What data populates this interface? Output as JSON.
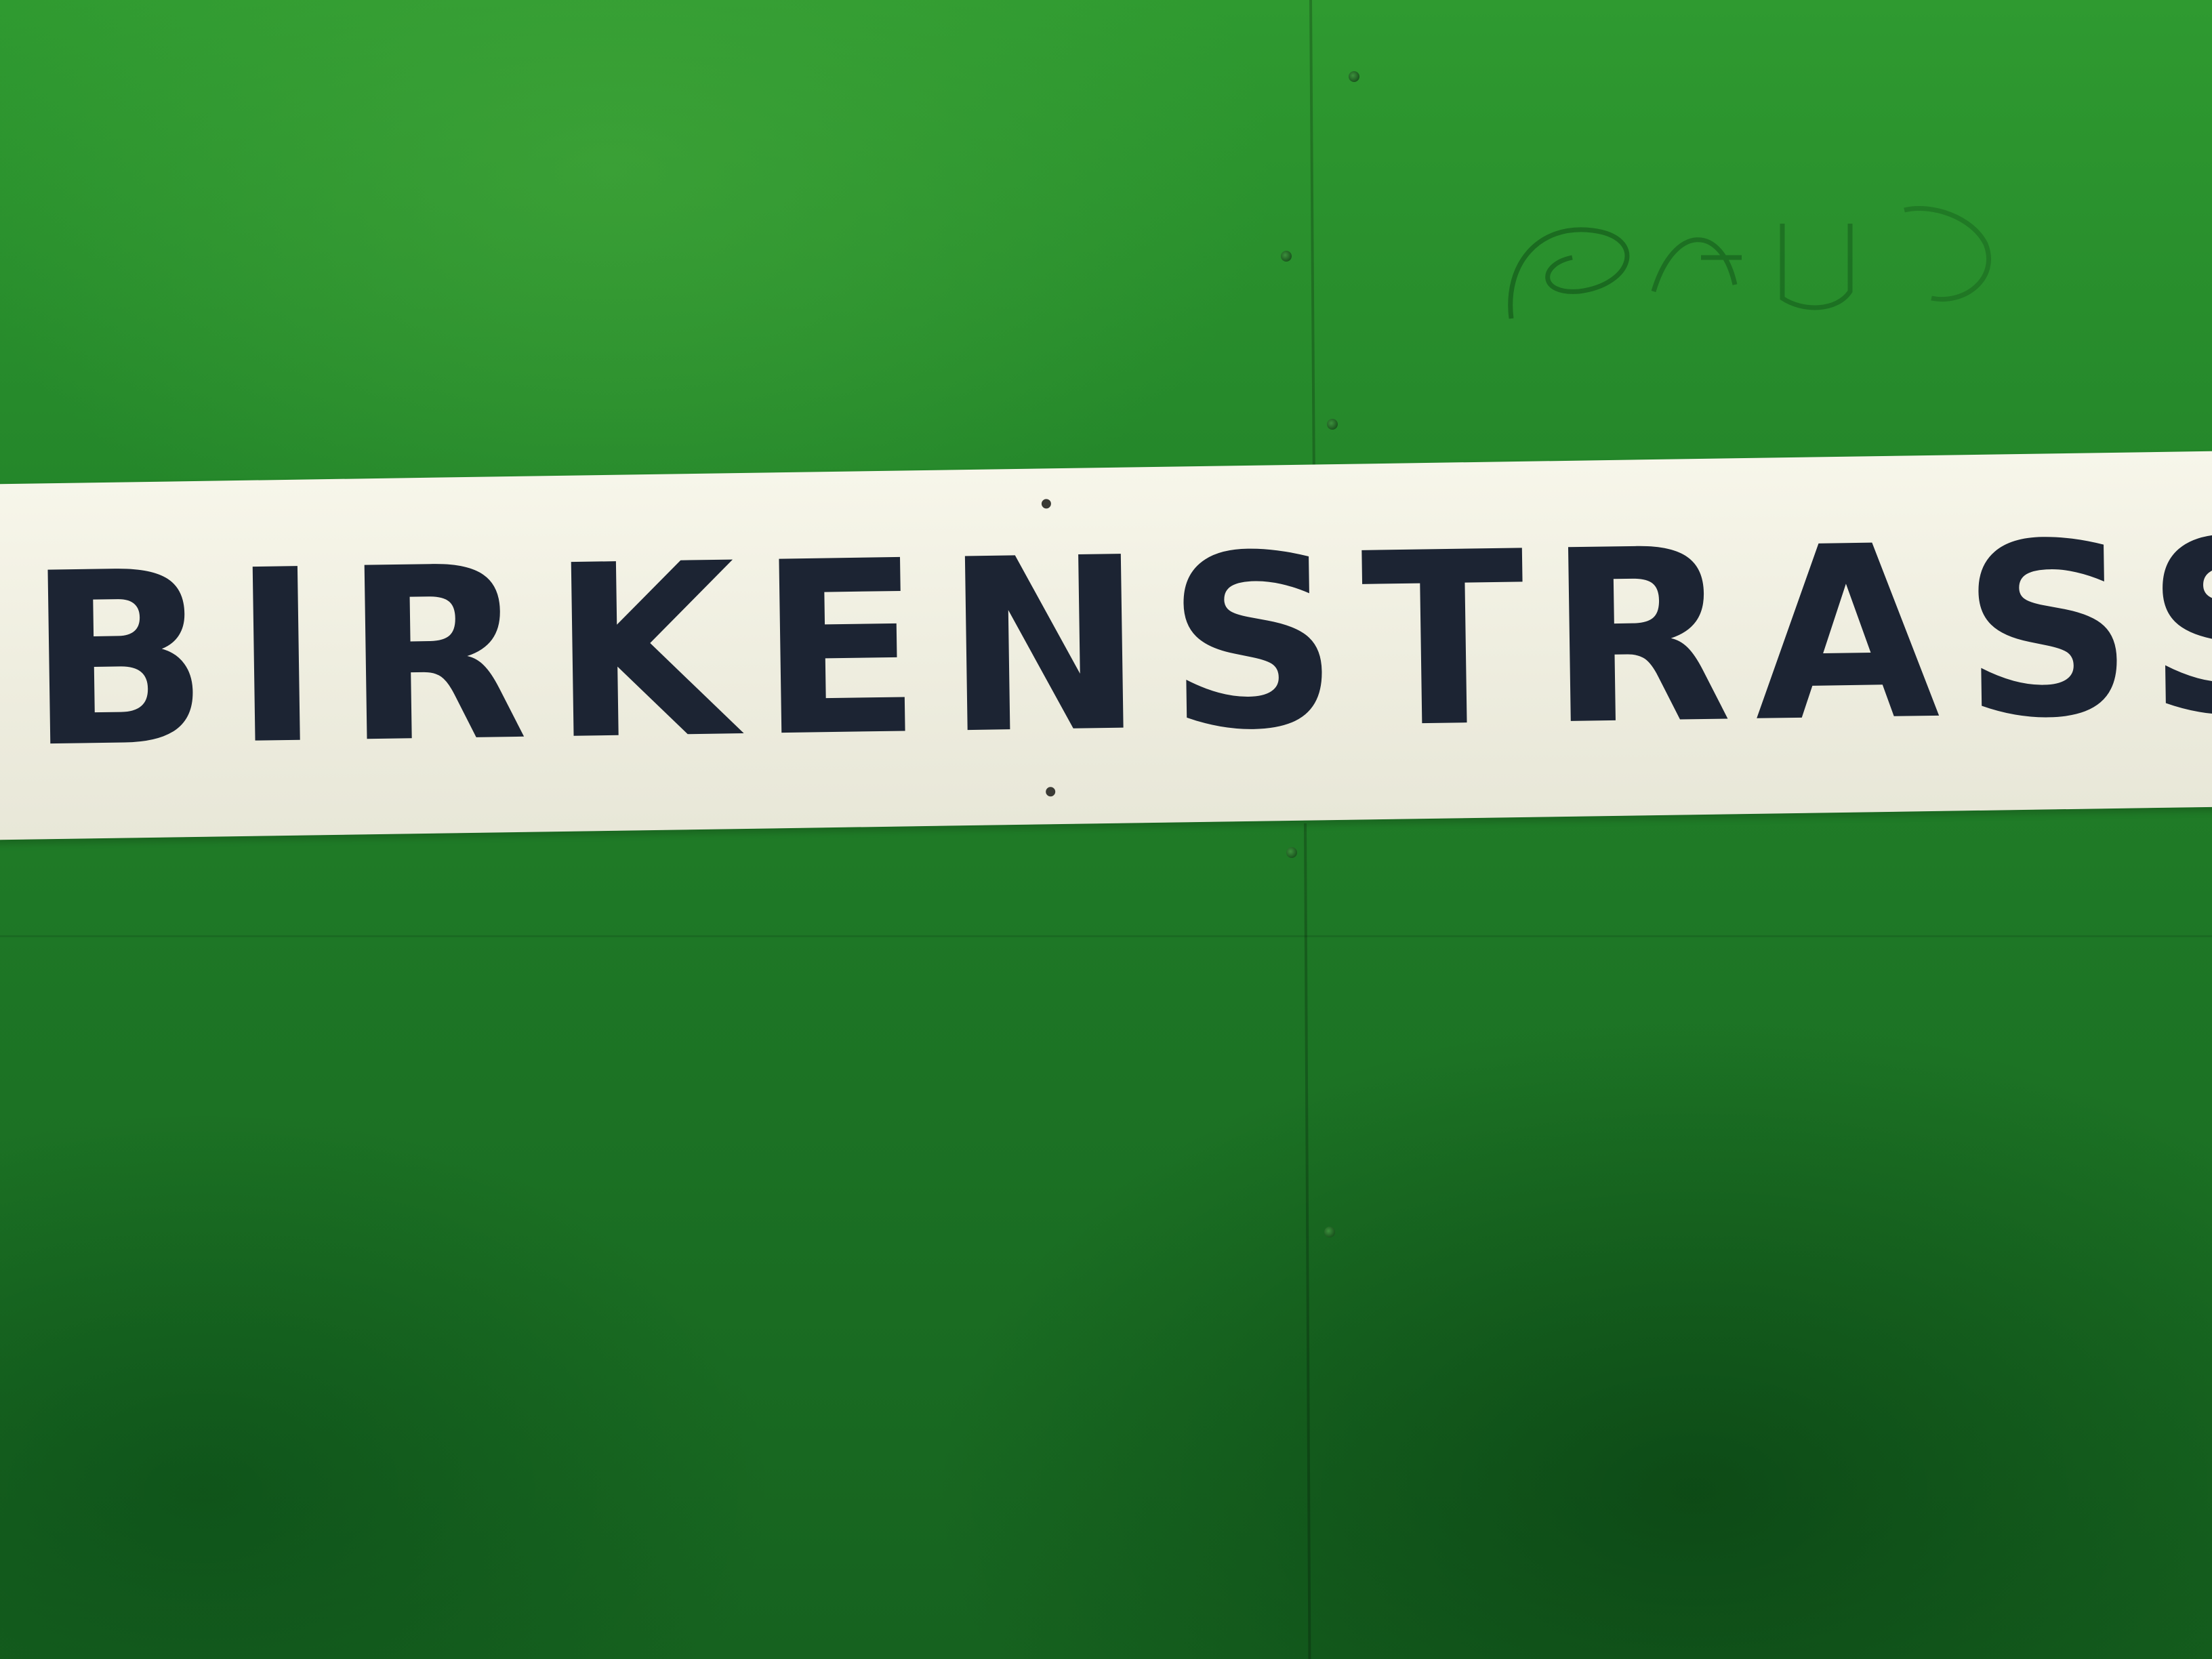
{
  "scene": {
    "wall_color": "#1f7a25",
    "sign_color": "#f2f1e4",
    "text_color": "#1c2433"
  },
  "sign": {
    "text": "BIRKENSTRASSE"
  }
}
